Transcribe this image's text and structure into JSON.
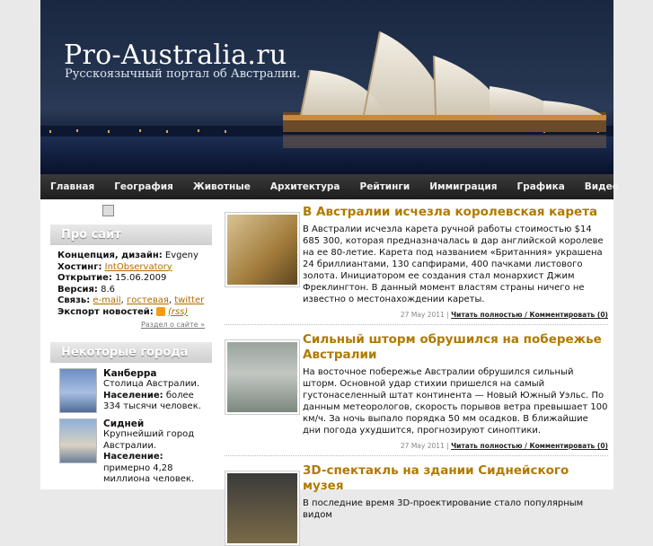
{
  "site": {
    "title": "Pro-Australia.ru",
    "subtitle": "Русскоязычный портал об Австралии."
  },
  "nav": [
    "Главная",
    "География",
    "Животные",
    "Архитектура",
    "Рейтинги",
    "Иммиграция",
    "Графика",
    "Видео"
  ],
  "about": {
    "title": "Про сайт",
    "concept_label": "Концепция, дизайн:",
    "concept_value": "Evgeny",
    "hosting_label": "Хостинг:",
    "hosting_value": "IntObservatory",
    "opened_label": "Открытие:",
    "opened_value": "15.06.2009",
    "version_label": "Версия:",
    "version_value": "8.6",
    "contact_label": "Связь:",
    "contact_email": "e-mail",
    "contact_guestbook": "гостевая",
    "contact_twitter": "twitter",
    "export_label": "Экспорт новостей:",
    "export_rss": "(rss)",
    "more": "Раздел о сайте »"
  },
  "cities": {
    "title": "Некоторые города",
    "items": [
      {
        "name": "Канберра",
        "desc": "Столица Австралии.",
        "pop_label": "Население:",
        "pop_value": "более 334 тысячи человек."
      },
      {
        "name": "Сидней",
        "desc": "Крупнейший город Австралии.",
        "pop_label": "Население:",
        "pop_value": "примерно 4,28 миллиона человек."
      }
    ]
  },
  "posts": [
    {
      "title": "В Австралии исчезла королевская карета",
      "text": "В Австралии исчезла карета ручной работы стоимостью $14 685 300, которая предназначалась в дар английской королеве на ее 80-летие. Карета под названием «Британния» украшена 24 бриллиантами, 130 сапфирами, 400 пачками листового золота. Инициатором ее создания стал монархист Джим Фреклингтон. В данный момент властям страны ничего не известно о местонахождении кареты.",
      "date": "27 May 2011",
      "link": "Читать полностью / Комментировать (0)"
    },
    {
      "title": "Сильный шторм обрушился на побережье Австралии",
      "text": "На восточное побережье Австралии обрушился сильный шторм. Основной удар стихии пришелся на самый густонаселенный штат континента — Новый Южный Уэльс. По данным метеорологов, скорость порывов ветра превышает 100 км/ч. За ночь выпало порядка 50 мм осадков. В ближайшие дни погода ухудшится, прогнозируют синоптики.",
      "date": "27 May 2011",
      "link": "Читать полностью / Комментировать (0)"
    },
    {
      "title": "3D-спектакль на здании Сиднейского музея",
      "text": "В последние время 3D-проектирование стало популярным видом",
      "date": "",
      "link": ""
    }
  ],
  "colors": {
    "accent": "#b07a00",
    "nav_bg": "#2a2a2a"
  }
}
